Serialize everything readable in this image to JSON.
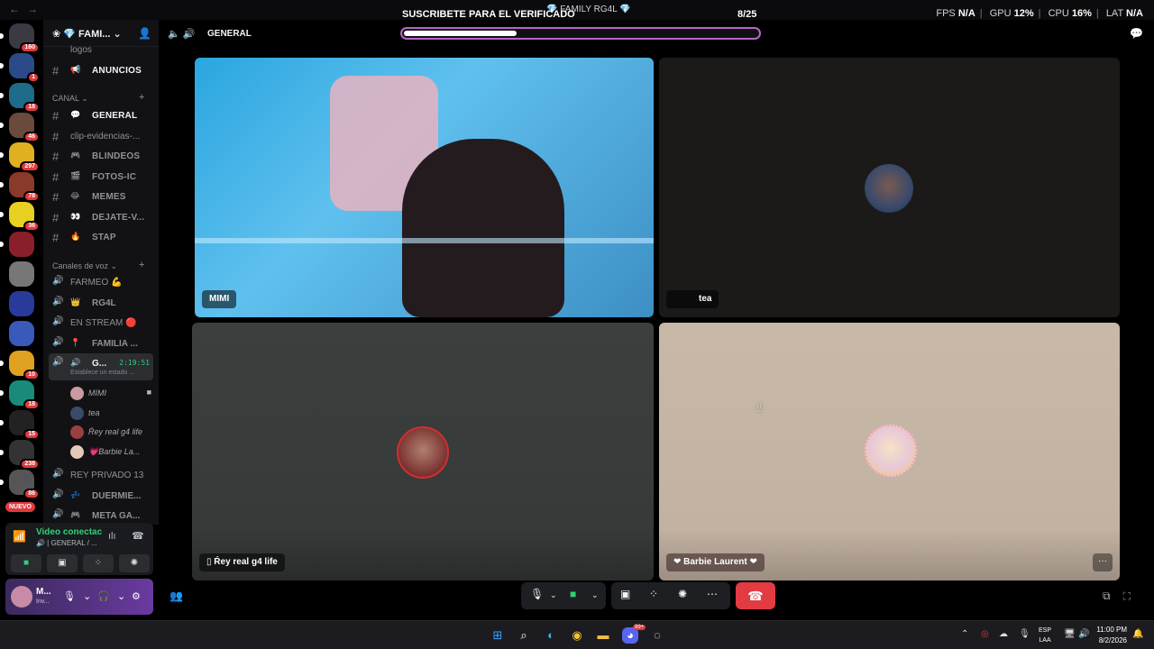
{
  "window": {
    "title": "FAMILY RG4L"
  },
  "overlay": {
    "title": "SUSCRIBETE PARA EL VERIFICADO",
    "count": "8/25",
    "progress_fraction": 0.32
  },
  "stats": {
    "fps_label": "FPS",
    "fps": "N/A",
    "gpu_label": "GPU",
    "gpu": "12%",
    "cpu_label": "CPU",
    "cpu": "16%",
    "lat_label": "LAT",
    "lat": "N/A"
  },
  "rail": {
    "servers": [
      {
        "badge": "160",
        "color": "#3a3a44"
      },
      {
        "badge": "1",
        "color": "#2a4a8a"
      },
      {
        "badge": "18",
        "color": "#1f6b8a"
      },
      {
        "badge": "46",
        "color": "#6a4a3a"
      },
      {
        "badge": "297",
        "color": "#e0b020"
      },
      {
        "badge": "78",
        "color": "#8a3a2a"
      },
      {
        "badge": "36",
        "color": "#e8d020"
      },
      {
        "badge": "",
        "color": "#8a1f2a"
      },
      {
        "badge": "",
        "color": "#777"
      },
      {
        "badge": "",
        "color": "#2a3a9a"
      },
      {
        "badge": "",
        "color": "#3a5aba"
      },
      {
        "badge": "10",
        "color": "#e0a020"
      },
      {
        "badge": "18",
        "color": "#1a8a7a"
      },
      {
        "badge": "15",
        "color": "#222"
      },
      {
        "badge": "238",
        "color": "#333"
      },
      {
        "badge": "86",
        "color": "#555"
      }
    ],
    "new_label": "NUEVO"
  },
  "sidebar": {
    "server_name": "FAMI...",
    "channels_top": [
      {
        "name": "logos"
      },
      {
        "emoji": "📢",
        "name": "ANUNCIOS"
      }
    ],
    "category_canal": "CANAL",
    "text_channels": [
      {
        "emoji": "💬",
        "name": "GENERAL",
        "active": true
      },
      {
        "plain": "clip-evidencias-..."
      },
      {
        "emoji": "🎮",
        "name": "BLINDEOS"
      },
      {
        "emoji": "🎬",
        "name": "FOTOS-IC"
      },
      {
        "emoji": "😂",
        "name": "MEMES"
      },
      {
        "emoji": "👀",
        "name": "DEJATE-V..."
      },
      {
        "emoji": "🔥",
        "name": "STAP"
      }
    ],
    "category_voice": "Canales de voz",
    "voice_channels": [
      {
        "plain": "FARMEO 💪"
      },
      {
        "emoji": "👑",
        "name": "RG4L"
      },
      {
        "plain": "EN STREAM 🔴"
      },
      {
        "emoji": "📍",
        "name": "FAMILIA ..."
      },
      {
        "emoji": "🔊",
        "name": "G...",
        "timer": "2:19:51",
        "status": "Establece un estado ...",
        "active": true
      }
    ],
    "members": [
      {
        "name": "MIMI",
        "camera": true
      },
      {
        "name": "tea"
      },
      {
        "name": "Ŕey real g4 life"
      },
      {
        "name": "💗Barbie La..."
      }
    ],
    "voice_channels_bottom": [
      {
        "plain": "REY PRIVADO 13"
      },
      {
        "emoji": "💤",
        "name": "DUERMIE..."
      },
      {
        "emoji": "🎮",
        "name": "META GA..."
      }
    ]
  },
  "voice_panel": {
    "status": "Video conectac",
    "location": "GENERAL / ..."
  },
  "user_panel": {
    "name": "M...",
    "status": "Inv..."
  },
  "main": {
    "channel_name": "GENERAL",
    "tiles": [
      {
        "name": "MIMI"
      },
      {
        "name": "tea"
      },
      {
        "name": "Ŕey real g4 life"
      },
      {
        "name": "Barbie Laurent"
      }
    ],
    "more_label": "···"
  },
  "taskbar": {
    "lang": "ESP",
    "lang2": "LAA",
    "time": "11:00 PM",
    "date": "8/2/2026",
    "discord_badge": "99+"
  }
}
